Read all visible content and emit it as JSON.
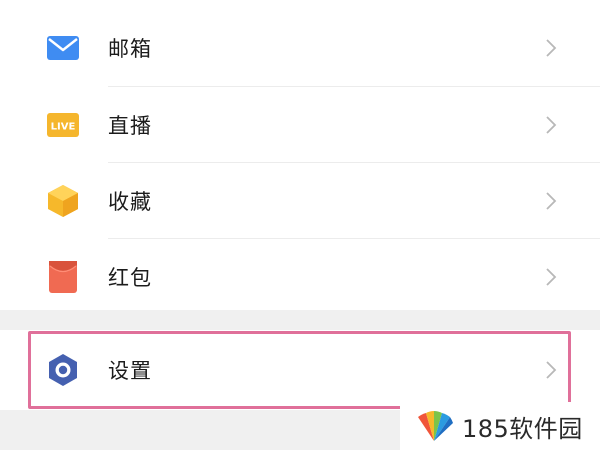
{
  "menu": {
    "items": [
      {
        "label": "邮箱",
        "icon": "mail-icon",
        "icon_color": "#3f8cf2"
      },
      {
        "label": "直播",
        "icon": "live-icon",
        "icon_color": "#f5b62d",
        "badge_text": "LIVE"
      },
      {
        "label": "收藏",
        "icon": "cube-icon",
        "icon_color": "#f6b82b"
      },
      {
        "label": "红包",
        "icon": "red-envelope-icon",
        "icon_color": "#f06a52"
      }
    ],
    "settings": {
      "label": "设置",
      "icon": "settings-hex-icon",
      "icon_color": "#4560b0"
    }
  },
  "highlight_color": "#e0709a",
  "watermark": {
    "text": "185软件园"
  }
}
